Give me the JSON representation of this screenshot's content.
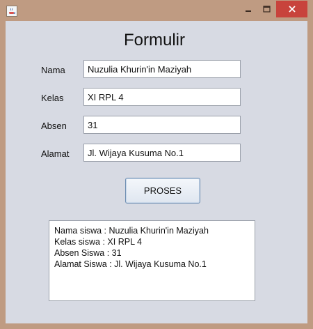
{
  "form": {
    "title": "Formulir",
    "fields": {
      "nama": {
        "label": "Nama",
        "value": "Nuzulia Khurin'in Maziyah"
      },
      "kelas": {
        "label": "Kelas",
        "value": "XI RPL 4"
      },
      "absen": {
        "label": "Absen",
        "value": "31"
      },
      "alamat": {
        "label": "Alamat",
        "value": "Jl. Wijaya Kusuma No.1"
      }
    },
    "button_label": "PROSES"
  },
  "output": {
    "lines": [
      "Nama siswa : Nuzulia Khurin'in Maziyah",
      "Kelas siswa : XI RPL 4",
      "Absen Siswa : 31",
      "Alamat Siswa : Jl. Wijaya Kusuma No.1"
    ]
  },
  "icons": {
    "app": "java-coffee-icon",
    "minimize": "minimize-icon",
    "maximize": "maximize-icon",
    "close": "close-icon"
  },
  "colors": {
    "frame": "#bf9b82",
    "panel": "#d7dae3",
    "close_button": "#c8433c"
  }
}
